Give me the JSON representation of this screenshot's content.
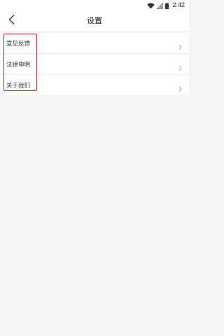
{
  "status_bar": {
    "time": "2:42",
    "icons": [
      "wifi-icon",
      "no-signal-icon",
      "battery-icon"
    ]
  },
  "nav": {
    "back_icon": "chevron-left-icon",
    "title": "设置"
  },
  "settings": {
    "items": [
      {
        "label": "意见反馈",
        "icon": "chevron-right-icon"
      },
      {
        "label": "法律申明",
        "icon": "chevron-right-icon"
      },
      {
        "label": "关于我们",
        "icon": "chevron-right-icon"
      }
    ]
  },
  "colors": {
    "page_background": "#f4f4f4",
    "card_background": "#ffffff",
    "highlight_border": "#e02020",
    "chevron": "#b0b0b0"
  }
}
